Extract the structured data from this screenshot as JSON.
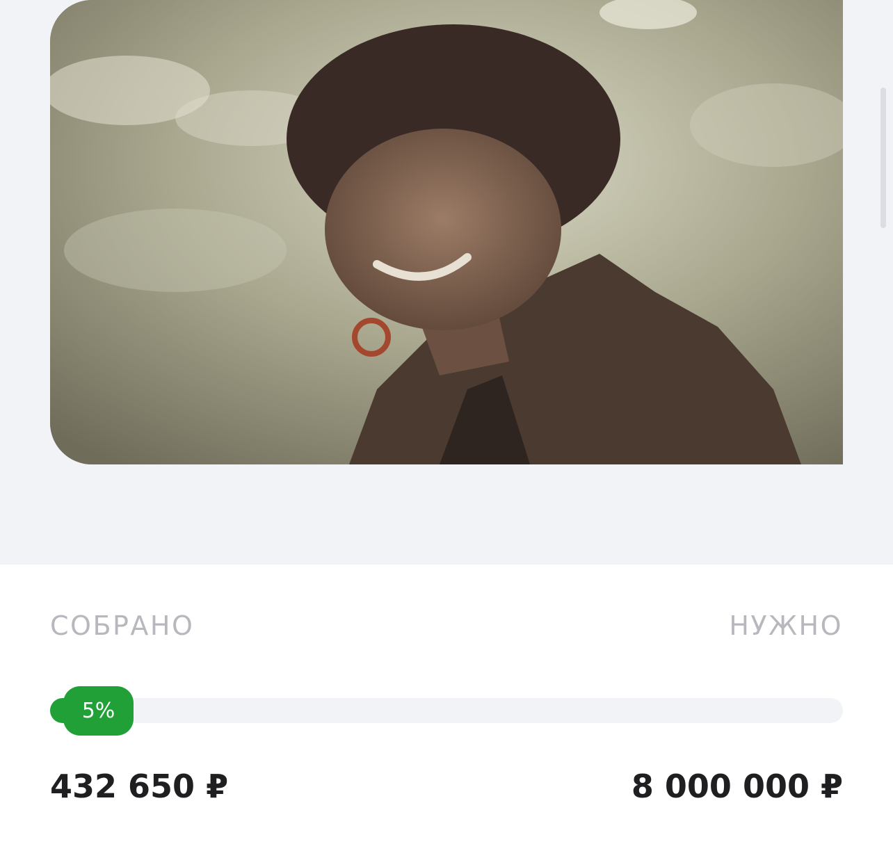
{
  "fundraiser": {
    "photo_alt": "woman-photo",
    "collected_label": "СОБРАНО",
    "needed_label": "НУЖНО",
    "progress_percent_label": "5%",
    "progress_value": 0.054,
    "collected_amount": "432 650 ₽",
    "needed_amount": "8 000 000 ₽"
  },
  "colors": {
    "accent": "#21a038",
    "background": "#f2f3f7",
    "label": "#b7b8bd",
    "text": "#1f1f22"
  }
}
